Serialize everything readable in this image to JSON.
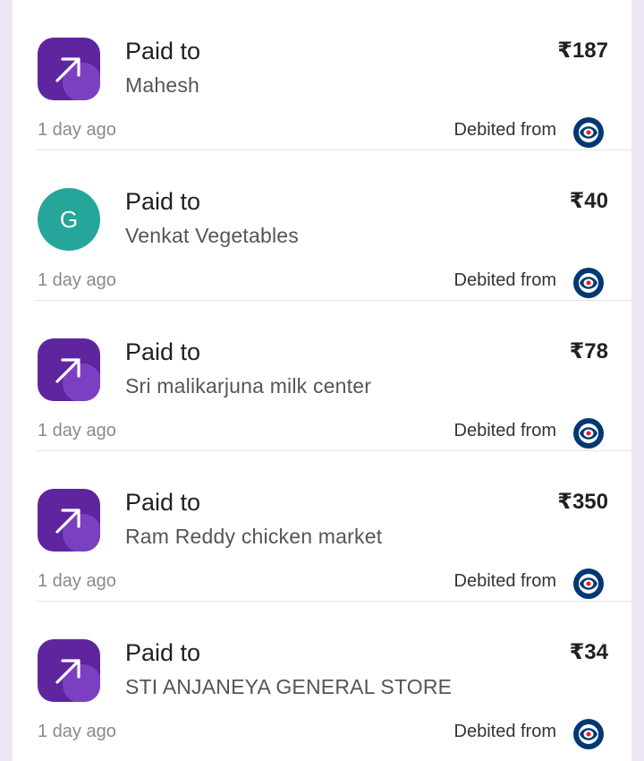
{
  "transactions": [
    {
      "label": "Paid to",
      "payee": "Mahesh",
      "amount": "₹187",
      "time": "1 day ago",
      "debited_label": "Debited from",
      "icon": "phonepe-send-arrow-icon"
    },
    {
      "label": "Paid to",
      "payee": "Venkat Vegetables",
      "amount": "₹40",
      "time": "1 day ago",
      "debited_label": "Debited from",
      "icon": "letter-avatar",
      "avatar_letter": "G",
      "avatar_color": "#26a69a"
    },
    {
      "label": "Paid to",
      "payee": "Sri malikarjuna milk center",
      "amount": "₹78",
      "time": "1 day ago",
      "debited_label": "Debited from",
      "icon": "phonepe-send-arrow-icon"
    },
    {
      "label": "Paid to",
      "payee": "Ram Reddy chicken market",
      "amount": "₹350",
      "time": "1 day ago",
      "debited_label": "Debited from",
      "icon": "phonepe-send-arrow-icon"
    },
    {
      "label": "Paid to",
      "payee": "STI ANJANEYA GENERAL STORE",
      "amount": "₹34",
      "time": "1 day ago",
      "debited_label": "Debited from",
      "icon": "phonepe-send-arrow-icon"
    }
  ],
  "bank_logo": {
    "icon": "kotak-bank-logo-icon",
    "color_primary": "#003874",
    "color_accent": "#ed1c24"
  },
  "colors": {
    "brand_purple": "#5f259f",
    "background": "#ece6f5"
  }
}
